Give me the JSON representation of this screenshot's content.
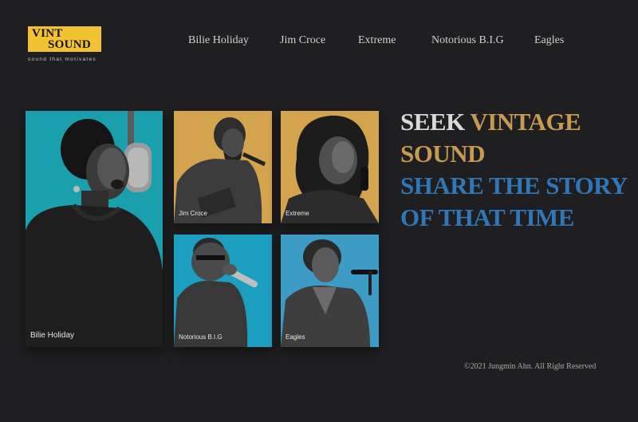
{
  "logo": {
    "line1": "VINT",
    "line2": "SOUND",
    "tagline": "sound that motivates",
    "color": "#f2c233"
  },
  "nav": {
    "items": [
      "Bilie Holiday",
      "Jim Croce",
      "Extreme",
      "Notorious B.I.G",
      "Eagles"
    ]
  },
  "cards": {
    "billie": "Bilie Holiday",
    "croce": "Jim Croce",
    "extreme": "Extreme",
    "big": "Notorious B.I.G",
    "eagles": "Eagles"
  },
  "headline": {
    "w1": "SEEK",
    "w2": "VINTAGE",
    "w3": "SOUND",
    "line3": "SHARE THE STORY",
    "line4": "OF THAT TIME",
    "colors": {
      "white": "#d9d9d9",
      "gold": "#c79a52",
      "blue": "#2f77b6"
    }
  },
  "footer": {
    "copyright": "©2021 Jungmin Ahn. All Right Reserved"
  }
}
